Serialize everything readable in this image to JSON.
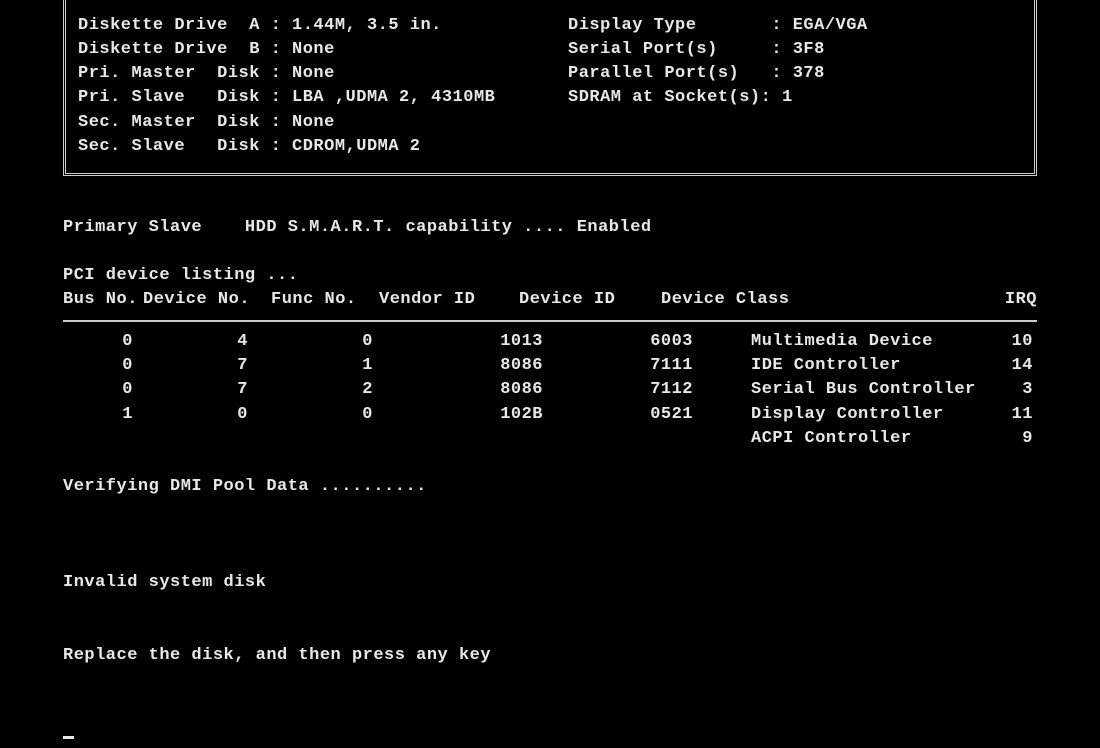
{
  "config": {
    "rows": [
      {
        "left_label": "Diskette Drive  A :",
        "left_value": "1.44M, 3.5 in.",
        "right_label": "Display Type       :",
        "right_value": "EGA/VGA"
      },
      {
        "left_label": "Diskette Drive  B :",
        "left_value": "None",
        "right_label": "Serial Port(s)     :",
        "right_value": "3F8"
      },
      {
        "left_label": "Pri. Master  Disk :",
        "left_value": "None",
        "right_label": "Parallel Port(s)   :",
        "right_value": "378"
      },
      {
        "left_label": "Pri. Slave   Disk :",
        "left_value": "LBA ,UDMA 2, 4310MB",
        "right_label": "SDRAM at Socket(s):",
        "right_value": "1"
      },
      {
        "left_label": "Sec. Master  Disk :",
        "left_value": "None",
        "right_label": "",
        "right_value": ""
      },
      {
        "left_label": "Sec. Slave   Disk :",
        "left_value": "CDROM,UDMA 2",
        "right_label": "",
        "right_value": ""
      }
    ]
  },
  "smart": {
    "label": "Primary Slave    HDD S.M.A.R.T. capability ....",
    "value": "Enabled"
  },
  "pci": {
    "title": "PCI device listing ...",
    "headers": {
      "bus": "Bus No.",
      "dev": "Device No.",
      "func": "Func No.",
      "vendor": "Vendor ID",
      "devid": "Device ID",
      "class": "Device Class",
      "irq": "IRQ"
    },
    "rows": [
      {
        "bus": "0",
        "dev": "4",
        "func": "0",
        "vendor": "1013",
        "devid": "6003",
        "class": "Multimedia Device",
        "irq": "10"
      },
      {
        "bus": "0",
        "dev": "7",
        "func": "1",
        "vendor": "8086",
        "devid": "7111",
        "class": "IDE Controller",
        "irq": "14"
      },
      {
        "bus": "0",
        "dev": "7",
        "func": "2",
        "vendor": "8086",
        "devid": "7112",
        "class": "Serial Bus Controller",
        "irq": "3"
      },
      {
        "bus": "1",
        "dev": "0",
        "func": "0",
        "vendor": "102B",
        "devid": "0521",
        "class": "Display Controller",
        "irq": "11"
      },
      {
        "bus": "",
        "dev": "",
        "func": "",
        "vendor": "",
        "devid": "",
        "class": "ACPI Controller",
        "irq": "9"
      }
    ]
  },
  "verifying": "Verifying DMI Pool Data ..........",
  "error": {
    "line1": "Invalid system disk",
    "line2": "Replace the disk, and then press any key"
  }
}
